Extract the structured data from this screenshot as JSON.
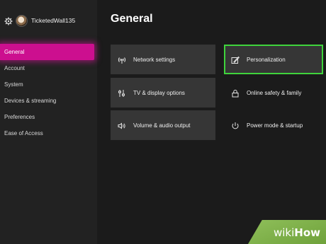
{
  "header": {
    "username": "TicketedWall135",
    "settings_icon": "gear-icon",
    "avatar": "user-avatar"
  },
  "sidebar": {
    "items": [
      {
        "label": "General",
        "active": true
      },
      {
        "label": "Account"
      },
      {
        "label": "System"
      },
      {
        "label": "Devices & streaming"
      },
      {
        "label": "Preferences"
      },
      {
        "label": "Ease of Access"
      }
    ]
  },
  "main": {
    "title": "General",
    "tiles": [
      {
        "label": "Network settings",
        "icon": "network-icon"
      },
      {
        "label": "Personalization",
        "icon": "personalization-icon",
        "highlighted": true
      },
      {
        "label": "TV & display options",
        "icon": "tv-icon"
      },
      {
        "label": "Online safety & family",
        "icon": "lock-icon"
      },
      {
        "label": "Volume & audio output",
        "icon": "speaker-icon"
      },
      {
        "label": "Power mode & startup",
        "icon": "power-icon"
      }
    ]
  },
  "colors": {
    "accent": "#cc0f8f",
    "highlight": "#3fd43c",
    "tile": "#363636",
    "background": "#1b1b1b"
  },
  "watermark": {
    "part1": "wiki",
    "part2": "How"
  }
}
